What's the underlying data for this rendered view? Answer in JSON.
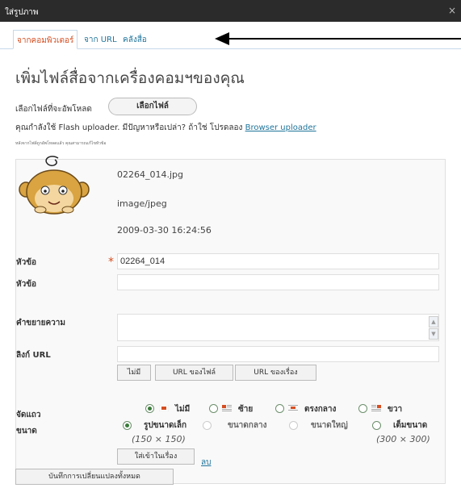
{
  "window": {
    "title": "ใส่รูปภาพ",
    "close_glyph": "×"
  },
  "tabs": [
    {
      "label": "จากคอมพิวเตอร์",
      "active": true
    },
    {
      "label": "จาก URL",
      "active": false
    },
    {
      "label": "คลังสื่อ",
      "active": false
    }
  ],
  "heading": "เพิ่มไฟล์สื่อจากเครื่องคอมฯของคุณ",
  "upload": {
    "choose_label": "เลือกไฟล์ที่จะอัพโหลด",
    "choose_button": "เลือกไฟล์",
    "flash_text": "คุณกำลังใช้ Flash uploader. มีปัญหาหรือเปล่า? ถ้าใช่ โปรดลอง",
    "browser_link": "Browser uploader",
    "note": "หลังจากไฟล์ถูกอัพโหลดแล้ว คุณสามารถแก้ไขหัวข้อ"
  },
  "media": {
    "filename": "02264_014.jpg",
    "mime": "image/jpeg",
    "date": "2009-03-30 16:24:56",
    "fields": {
      "title_label": "หัวข้อ",
      "title_value": "02264_014",
      "caption_label": "หัวข้อ",
      "caption_value": "",
      "description_label": "คำขยายความ",
      "link_label": "ลิงก์ URL",
      "link_value": ""
    },
    "link_buttons": [
      "ไม่มี",
      "URL ของไฟล์",
      "URL ของเรื่อง"
    ],
    "align": {
      "label": "จัดแถว",
      "options": [
        {
          "label": "ไม่มี",
          "checked": true
        },
        {
          "label": "ซ้าย",
          "checked": false
        },
        {
          "label": "ตรงกลาง",
          "checked": false
        },
        {
          "label": "ขวา",
          "checked": false
        }
      ]
    },
    "size": {
      "label": "ขนาด",
      "options": [
        {
          "label": "รูปขนาดเล็ก",
          "dims": "(150 × 150)",
          "checked": true,
          "disabled": false
        },
        {
          "label": "ขนาดกลาง",
          "dims": "",
          "checked": false,
          "disabled": true
        },
        {
          "label": "ขนาดใหญ่",
          "dims": "",
          "checked": false,
          "disabled": true
        },
        {
          "label": "เต็มขนาด",
          "dims": "(300 × 300)",
          "checked": false,
          "disabled": false
        }
      ]
    },
    "insert_button": "ใส่เข้าในเรื่อง",
    "delete_link": "ลบ"
  },
  "save_all": "บันทึกการเปลี่ยนแปลงทั้งหมด",
  "colors": {
    "accent": "#d54e21",
    "link": "#21759b",
    "titlebar": "#2b2b2b"
  }
}
